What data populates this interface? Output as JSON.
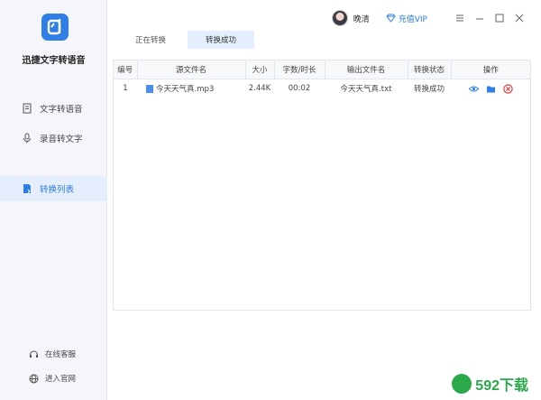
{
  "app": {
    "name": "迅捷文字转语音",
    "colors": {
      "accent": "#2f7fe6",
      "sidebar_bg": "#f4f6f9",
      "danger": "#e33b3b"
    }
  },
  "sidebar": {
    "items": [
      {
        "label": "文字转语音",
        "icon": "text-doc-icon",
        "active": false
      },
      {
        "label": "录音转文字",
        "icon": "microphone-icon",
        "active": false
      },
      {
        "label": "转换列表",
        "icon": "list-file-icon",
        "active": true
      }
    ],
    "footer": [
      {
        "label": "在线客服",
        "icon": "headset-icon"
      },
      {
        "label": "进入官网",
        "icon": "globe-icon"
      }
    ]
  },
  "header": {
    "username": "晚清",
    "vip_label": "充值VIP",
    "window_controls": [
      "menu-icon",
      "minimize-icon",
      "maximize-icon",
      "close-icon"
    ]
  },
  "tabs": [
    {
      "label": "正在转换",
      "active": false
    },
    {
      "label": "转换成功",
      "active": true
    }
  ],
  "table": {
    "columns": [
      "编号",
      "源文件名",
      "大小",
      "字数/时长",
      "输出文件名",
      "转换状态",
      "操作"
    ],
    "rows": [
      {
        "index": "1",
        "source": "今天天气真.mp3",
        "size": "2.44K",
        "duration": "00:02",
        "output": "今天天气真.txt",
        "status": "转换成功",
        "actions": [
          "eye-icon",
          "folder-icon",
          "delete-icon"
        ]
      }
    ]
  },
  "watermark": {
    "text": "592下载"
  }
}
